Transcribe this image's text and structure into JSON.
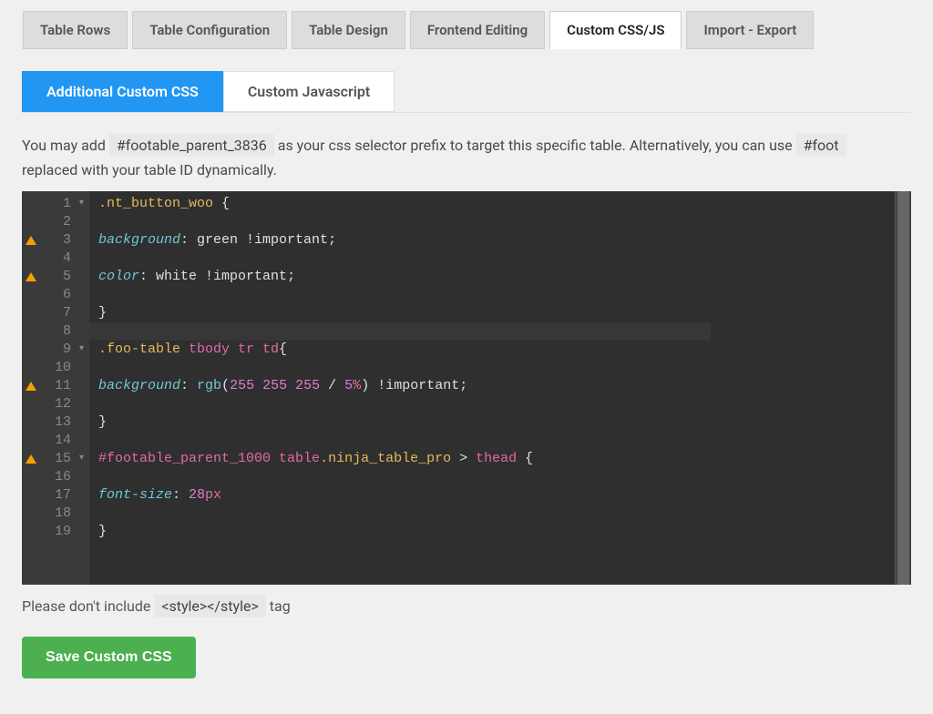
{
  "topTabs": [
    {
      "label": "Table Rows",
      "active": false
    },
    {
      "label": "Table Configuration",
      "active": false
    },
    {
      "label": "Table Design",
      "active": false
    },
    {
      "label": "Frontend Editing",
      "active": false
    },
    {
      "label": "Custom CSS/JS",
      "active": true
    },
    {
      "label": "Import - Export",
      "active": false
    }
  ],
  "subTabs": [
    {
      "label": "Additional Custom CSS",
      "active": true
    },
    {
      "label": "Custom Javascript",
      "active": false
    }
  ],
  "help": {
    "pre": "You may add ",
    "selectorCode": "#footable_parent_3836",
    "mid": " as your css selector prefix to target this specific table. Alternatively, you can use ",
    "suffixCode": "#foot",
    "line2": "replaced with your table ID dynamically."
  },
  "editor": {
    "lines": [
      {
        "n": 1,
        "warn": false,
        "fold": true
      },
      {
        "n": 2,
        "warn": false,
        "fold": false
      },
      {
        "n": 3,
        "warn": true,
        "fold": false
      },
      {
        "n": 4,
        "warn": false,
        "fold": false
      },
      {
        "n": 5,
        "warn": true,
        "fold": false
      },
      {
        "n": 6,
        "warn": false,
        "fold": false
      },
      {
        "n": 7,
        "warn": false,
        "fold": false
      },
      {
        "n": 8,
        "warn": false,
        "fold": false
      },
      {
        "n": 9,
        "warn": false,
        "fold": true
      },
      {
        "n": 10,
        "warn": false,
        "fold": false
      },
      {
        "n": 11,
        "warn": true,
        "fold": false
      },
      {
        "n": 12,
        "warn": false,
        "fold": false
      },
      {
        "n": 13,
        "warn": false,
        "fold": false
      },
      {
        "n": 14,
        "warn": false,
        "fold": false
      },
      {
        "n": 15,
        "warn": true,
        "fold": true
      },
      {
        "n": 16,
        "warn": false,
        "fold": false
      },
      {
        "n": 17,
        "warn": false,
        "fold": false
      },
      {
        "n": 18,
        "warn": false,
        "fold": false
      },
      {
        "n": 19,
        "warn": false,
        "fold": false
      }
    ],
    "code": {
      "l1": {
        "sel": ".nt_button_woo",
        "brace": " {"
      },
      "l3": {
        "prop": "background",
        "colon": ": ",
        "val": "green ",
        "imp": "!important",
        "semi": ";"
      },
      "l5": {
        "prop": "color",
        "colon": ": ",
        "val": "white ",
        "imp": "!important",
        "semi": ";"
      },
      "l7": {
        "brace": "}"
      },
      "l9": {
        "sel": ".foo-table",
        "rest": " tbody tr td",
        "brace": "{"
      },
      "l11": {
        "prop": "background",
        "colon": ": ",
        "func": "rgb",
        "open": "(",
        "n1": "255",
        "sp1": " ",
        "n2": "255",
        "sp2": " ",
        "n3": "255",
        "slash": " / ",
        "n4": "5",
        "pct": "%",
        "close": ")",
        "sp3": " ",
        "imp": "!important",
        "semi": ";"
      },
      "l13": {
        "brace": "}"
      },
      "l15": {
        "id": "#footable_parent_1000",
        "sp": " ",
        "el": "table",
        "cls": ".ninja_table_pro",
        "gt": " > ",
        "el2": "thead",
        "brace": " {"
      },
      "l17": {
        "prop": "font-size",
        "colon": ": ",
        "num": "28",
        "unit": "px"
      },
      "l19": {
        "brace": "}"
      }
    }
  },
  "footer": {
    "pre": "Please don't include ",
    "code": "<style></style>",
    "post": " tag"
  },
  "saveButton": "Save Custom CSS"
}
